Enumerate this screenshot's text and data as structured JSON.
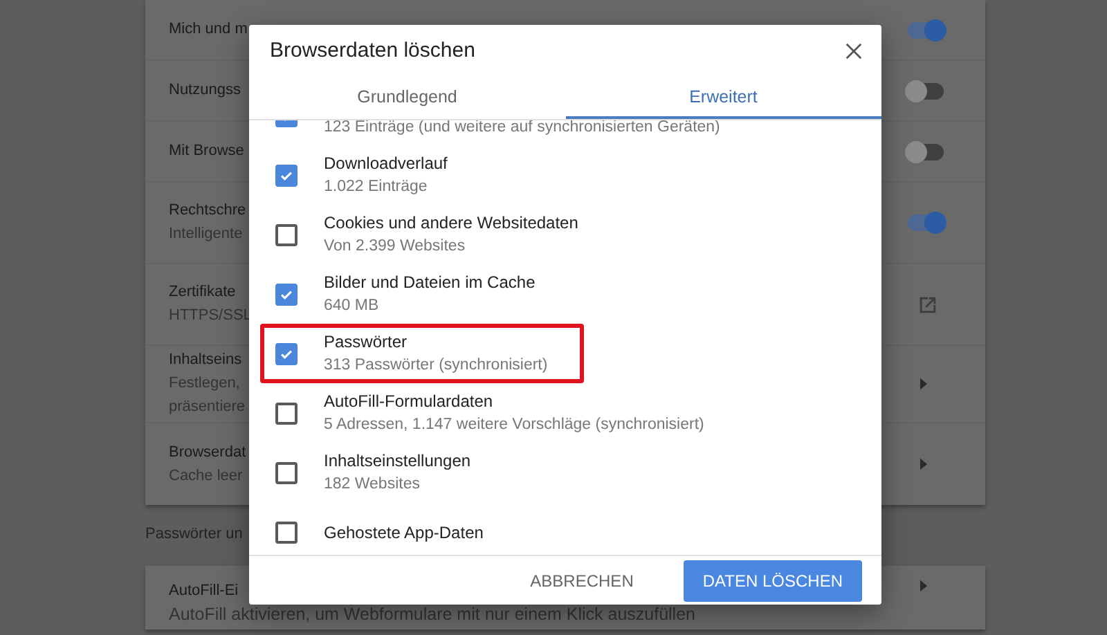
{
  "settings": {
    "rows": [
      {
        "title": "Mich und m",
        "toggle": {
          "on": true
        }
      },
      {
        "title": "Nutzungss",
        "toggle": {
          "on": false
        }
      },
      {
        "title": "Mit Browse",
        "toggle": {
          "on": false
        }
      },
      {
        "title": "Rechtschre",
        "subtitle": [
          "Intelligente"
        ],
        "toggle": {
          "on": true
        }
      },
      {
        "title": "Zertifikate",
        "subtitle": [
          "HTTPS/SSL"
        ],
        "kind": "external"
      },
      {
        "title": "Inhaltseins",
        "subtitle": [
          "Festlegen,",
          "präsentiere"
        ],
        "kind": "arrow"
      },
      {
        "title": "Browserdat",
        "subtitle": [
          "Cache leer"
        ],
        "kind": "arrow"
      }
    ],
    "section": "Passwörter un",
    "rows2": [
      {
        "title": "AutoFill-Ei",
        "subtitle": [
          "AutoFill aktivieren, um Webformulare mit nur einem Klick auszufüllen"
        ],
        "kind": "arrow"
      }
    ]
  },
  "dialog": {
    "title": "Browserdaten löschen",
    "tabs": [
      {
        "label": "Grundlegend",
        "selected": false
      },
      {
        "label": "Erweitert",
        "selected": true
      }
    ],
    "items": [
      {
        "detail": "123 Einträge (und weitere auf synchronisierten Geräten)",
        "checked": true,
        "highlighted": false
      },
      {
        "title": "Downloadverlauf",
        "detail": "1.022 Einträge",
        "checked": true,
        "highlighted": false
      },
      {
        "title": "Cookies und andere Websitedaten",
        "detail": "Von 2.399 Websites",
        "checked": false,
        "highlighted": false
      },
      {
        "title": "Bilder und Dateien im Cache",
        "detail": "640 MB",
        "checked": true,
        "highlighted": false
      },
      {
        "title": "Passwörter",
        "detail": "313 Passwörter (synchronisiert)",
        "checked": true,
        "highlighted": true
      },
      {
        "title": "AutoFill-Formulardaten",
        "detail": "5 Adressen, 1.147 weitere Vorschläge (synchronisiert)",
        "checked": false,
        "highlighted": false
      },
      {
        "title": "Inhaltseinstellungen",
        "detail": "182 Websites",
        "checked": false,
        "highlighted": false
      },
      {
        "title": "Gehostete App-Daten",
        "checked": false,
        "highlighted": false
      }
    ],
    "buttons": [
      {
        "label": "ABBRECHEN",
        "kind": "text"
      },
      {
        "label": "DATEN LÖSCHEN",
        "kind": "primary"
      }
    ]
  }
}
